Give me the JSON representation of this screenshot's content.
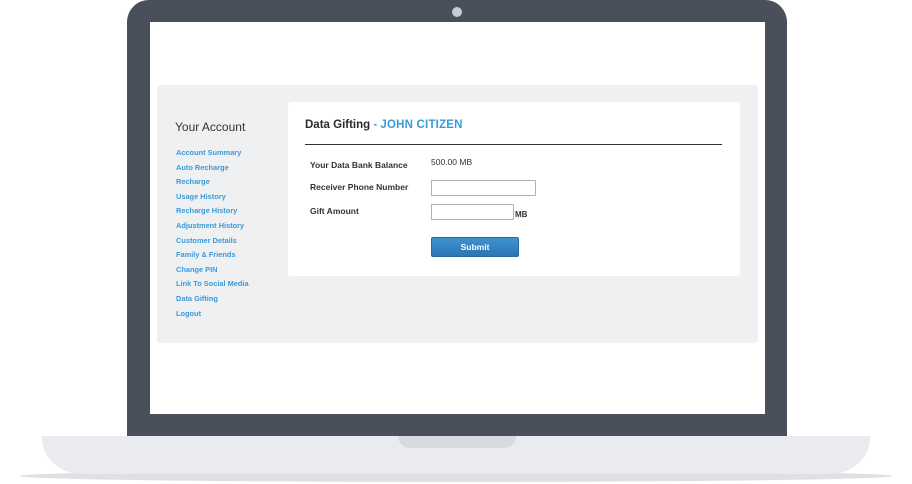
{
  "sidebar": {
    "title": "Your Account",
    "items": [
      {
        "label": "Account Summary"
      },
      {
        "label": "Auto Recharge"
      },
      {
        "label": "Recharge"
      },
      {
        "label": "Usage History"
      },
      {
        "label": "Recharge History"
      },
      {
        "label": "Adjustment History"
      },
      {
        "label": "Customer Details"
      },
      {
        "label": "Family & Friends"
      },
      {
        "label": "Change PIN"
      },
      {
        "label": "Link To Social Media"
      },
      {
        "label": "Data Gifting"
      },
      {
        "label": "Logout"
      }
    ]
  },
  "main": {
    "title": "Data Gifting",
    "separator": " - ",
    "customer_name": "JOHN CITIZEN",
    "balance_label": "Your Data Bank Balance",
    "balance_value": "500.00 MB",
    "phone_label": "Receiver Phone Number",
    "phone_value": "",
    "gift_label": "Gift Amount",
    "gift_value": "",
    "gift_unit": "MB",
    "submit_label": "Submit"
  },
  "colors": {
    "accent": "#3a9ad9",
    "laptop_frame": "#4a4f5c",
    "panel_bg": "#eff0f2",
    "button": "#2b7cbf"
  }
}
